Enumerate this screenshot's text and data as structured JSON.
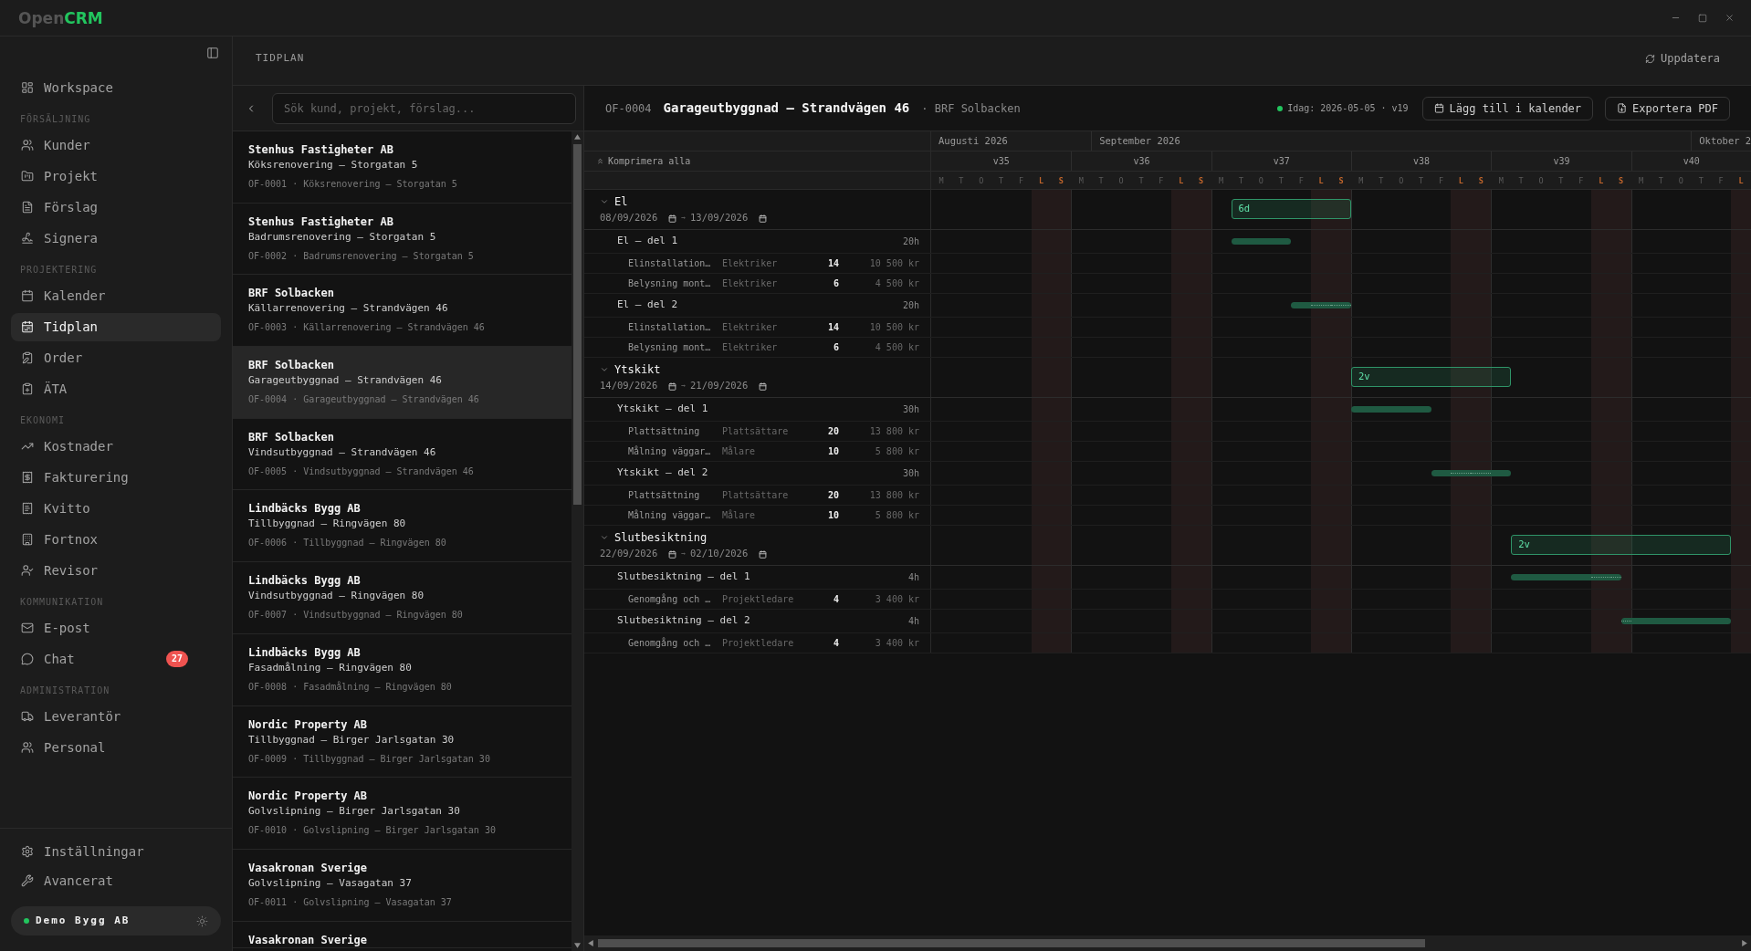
{
  "title_bar": {
    "logo": {
      "prefix": "Open",
      "accent": "CRM"
    }
  },
  "sidebar": {
    "top_items": [
      {
        "label": "Workspace",
        "selected": false
      }
    ],
    "sections": [
      {
        "title": "FÖRSÄLJNING",
        "items": [
          {
            "label": "Kunder",
            "selected": false
          },
          {
            "label": "Projekt",
            "selected": false
          },
          {
            "label": "Förslag",
            "selected": false
          },
          {
            "label": "Signera",
            "selected": false
          }
        ]
      },
      {
        "title": "PROJEKTERING",
        "items": [
          {
            "label": "Kalender",
            "selected": false
          },
          {
            "label": "Tidplan",
            "selected": true
          },
          {
            "label": "Order",
            "selected": false
          },
          {
            "label": "ÄTA",
            "selected": false
          }
        ]
      },
      {
        "title": "EKONOMI",
        "items": [
          {
            "label": "Kostnader",
            "selected": false
          },
          {
            "label": "Fakturering",
            "selected": false
          },
          {
            "label": "Kvitto",
            "selected": false
          },
          {
            "label": "Fortnox",
            "selected": false
          },
          {
            "label": "Revisor",
            "selected": false
          }
        ]
      },
      {
        "title": "KOMMUNIKATION",
        "items": [
          {
            "label": "E-post",
            "selected": false
          },
          {
            "label": "Chat",
            "selected": false,
            "badge": "27"
          }
        ]
      },
      {
        "title": "ADMINISTRATION",
        "items": [
          {
            "label": "Leverantör",
            "selected": false
          },
          {
            "label": "Personal",
            "selected": false
          }
        ]
      }
    ],
    "footer_items": [
      {
        "label": "Inställningar",
        "selected": false
      },
      {
        "label": "Avancerat",
        "selected": false
      }
    ],
    "company": {
      "name": "Demo Bygg AB"
    }
  },
  "page_header": {
    "title": "TIDPLAN",
    "refresh_button": "Uppdatera"
  },
  "project_list": {
    "search": {
      "placeholder": "Sök kund, projekt, förslag..."
    },
    "items": [
      {
        "customer": "Stenhus Fastigheter AB",
        "project": "Köksrenovering — Storgatan 5",
        "reference": "OF-0001 · Köksrenovering — Storgatan 5",
        "selected": false
      },
      {
        "customer": "Stenhus Fastigheter AB",
        "project": "Badrumsrenovering — Storgatan 5",
        "reference": "OF-0002 · Badrumsrenovering — Storgatan 5",
        "selected": false
      },
      {
        "customer": "BRF Solbacken",
        "project": "Källarrenovering — Strandvägen 46",
        "reference": "OF-0003 · Källarrenovering — Strandvägen 46",
        "selected": false
      },
      {
        "customer": "BRF Solbacken",
        "project": "Garageutbyggnad — Strandvägen 46",
        "reference": "OF-0004 · Garageutbyggnad — Strandvägen 46",
        "selected": true
      },
      {
        "customer": "BRF Solbacken",
        "project": "Vindsutbyggnad — Strandvägen 46",
        "reference": "OF-0005 · Vindsutbyggnad — Strandvägen 46",
        "selected": false
      },
      {
        "customer": "Lindbäcks Bygg AB",
        "project": "Tillbyggnad — Ringvägen 80",
        "reference": "OF-0006 · Tillbyggnad — Ringvägen 80",
        "selected": false
      },
      {
        "customer": "Lindbäcks Bygg AB",
        "project": "Vindsutbyggnad — Ringvägen 80",
        "reference": "OF-0007 · Vindsutbyggnad — Ringvägen 80",
        "selected": false
      },
      {
        "customer": "Lindbäcks Bygg AB",
        "project": "Fasadmålning — Ringvägen 80",
        "reference": "OF-0008 · Fasadmålning — Ringvägen 80",
        "selected": false
      },
      {
        "customer": "Nordic Property AB",
        "project": "Tillbyggnad — Birger Jarlsgatan 30",
        "reference": "OF-0009 · Tillbyggnad — Birger Jarlsgatan 30",
        "selected": false
      },
      {
        "customer": "Nordic Property AB",
        "project": "Golvslipning — Birger Jarlsgatan 30",
        "reference": "OF-0010 · Golvslipning — Birger Jarlsgatan 30",
        "selected": false
      },
      {
        "customer": "Vasakronan Sverige",
        "project": "Golvslipning — Vasagatan 37",
        "reference": "OF-0011 · Golvslipning — Vasagatan 37",
        "selected": false
      },
      {
        "customer": "Vasakronan Sverige",
        "selected": false
      }
    ]
  },
  "schedule": {
    "code": "OF-0004",
    "title": "Garageutbyggnad — Strandvägen 46",
    "customer": "· BRF Solbacken",
    "today": "Idag: 2026-05-05 · v19",
    "buttons": [
      "Lägg till i kalender",
      "Exportera PDF"
    ],
    "collapse_all": "Komprimera alla",
    "timeline": {
      "months": [
        {
          "label": "Augusti 2026",
          "days": [
            {
              "label": "M",
              "weekend": false
            },
            {
              "label": "T",
              "weekend": false
            },
            {
              "label": "O",
              "weekend": false
            },
            {
              "label": "T",
              "weekend": false
            },
            {
              "label": "F",
              "weekend": false
            },
            {
              "label": "L",
              "weekend": true
            },
            {
              "label": "S",
              "weekend": true
            },
            {
              "label": "M",
              "weekend": false
            }
          ]
        },
        {
          "label": "September 2026",
          "days": [
            {
              "label": "T",
              "weekend": false
            },
            {
              "label": "O",
              "weekend": false
            },
            {
              "label": "T",
              "weekend": false
            },
            {
              "label": "F",
              "weekend": false
            },
            {
              "label": "L",
              "weekend": true
            },
            {
              "label": "S",
              "weekend": true
            },
            {
              "label": "M",
              "weekend": false
            },
            {
              "label": "T",
              "weekend": false
            },
            {
              "label": "O",
              "weekend": false
            },
            {
              "label": "T",
              "weekend": false
            },
            {
              "label": "F",
              "weekend": false
            },
            {
              "label": "L",
              "weekend": true
            },
            {
              "label": "S",
              "weekend": true
            },
            {
              "label": "M",
              "weekend": false
            },
            {
              "label": "T",
              "weekend": false
            },
            {
              "label": "O",
              "weekend": false
            },
            {
              "label": "T",
              "weekend": false
            },
            {
              "label": "F",
              "weekend": false
            },
            {
              "label": "L",
              "weekend": true
            },
            {
              "label": "S",
              "weekend": true
            },
            {
              "label": "M",
              "weekend": false
            },
            {
              "label": "T",
              "weekend": false
            },
            {
              "label": "O",
              "weekend": false
            },
            {
              "label": "T",
              "weekend": false
            },
            {
              "label": "F",
              "weekend": false
            },
            {
              "label": "L",
              "weekend": true
            },
            {
              "label": "S",
              "weekend": true
            },
            {
              "label": "M",
              "weekend": false
            },
            {
              "label": "T",
              "weekend": false
            },
            {
              "label": "O",
              "weekend": false
            }
          ]
        },
        {
          "label": "Oktober 2",
          "days": [
            {
              "label": "T",
              "weekend": false
            },
            {
              "label": "F",
              "weekend": false
            },
            {
              "label": "L",
              "weekend": true
            }
          ]
        }
      ],
      "weeks": [
        "v35",
        "v36",
        "v37",
        "v38",
        "v39",
        "v40"
      ]
    },
    "rows": [
      {
        "name": "El",
        "expanded": true,
        "start_date": "08/09/2026",
        "arrow": "→",
        "end_date": "13/09/2026",
        "duration": "6d",
        "children": [
          {
            "name": "El — del 1",
            "hours": "20h",
            "children": [
              {
                "name": "Elinstallation…",
                "role": "Elektriker",
                "quantity": "14",
                "cost": "10 500 kr"
              },
              {
                "name": "Belysning mont…",
                "role": "Elektriker",
                "quantity": "6",
                "cost": "4 500 kr"
              }
            ]
          },
          {
            "name": "El — del 2",
            "hours": "20h",
            "children": [
              {
                "name": "Elinstallation…",
                "role": "Elektriker",
                "quantity": "14",
                "cost": "10 500 kr"
              },
              {
                "name": "Belysning mont…",
                "role": "Elektriker",
                "quantity": "6",
                "cost": "4 500 kr"
              }
            ]
          }
        ]
      },
      {
        "name": "Ytskikt",
        "expanded": true,
        "start_date": "14/09/2026",
        "arrow": "→",
        "end_date": "21/09/2026",
        "duration": "2v",
        "children": [
          {
            "name": "Ytskikt — del 1",
            "hours": "30h",
            "children": [
              {
                "name": "Plattsättning",
                "role": "Plattsättare",
                "quantity": "20",
                "cost": "13 800 kr"
              },
              {
                "name": "Målning väggar…",
                "role": "Målare",
                "quantity": "10",
                "cost": "5 800 kr"
              }
            ]
          },
          {
            "name": "Ytskikt — del 2",
            "hours": "30h",
            "children": [
              {
                "name": "Plattsättning",
                "role": "Plattsättare",
                "quantity": "20",
                "cost": "13 800 kr"
              },
              {
                "name": "Målning väggar…",
                "role": "Målare",
                "quantity": "10",
                "cost": "5 800 kr"
              }
            ]
          }
        ]
      },
      {
        "name": "Slutbesiktning",
        "expanded": true,
        "start_date": "22/09/2026",
        "arrow": "→",
        "end_date": "02/10/2026",
        "duration": "2v",
        "children": [
          {
            "name": "Slutbesiktning — del 1",
            "hours": "4h",
            "children": [
              {
                "name": "Genomgång och …",
                "role": "Projektledare",
                "quantity": "4",
                "cost": "3 400 kr"
              }
            ]
          },
          {
            "name": "Slutbesiktning — del 2",
            "hours": "4h",
            "children": [
              {
                "name": "Genomgång och …",
                "role": "Projektledare",
                "quantity": "4",
                "cost": "3 400 kr"
              }
            ]
          }
        ]
      }
    ]
  }
}
